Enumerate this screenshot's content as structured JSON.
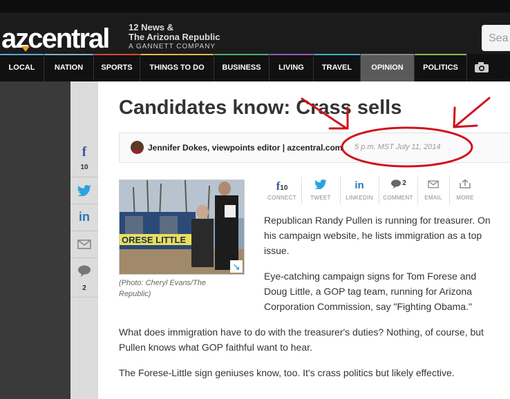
{
  "header": {
    "logo": "azcentral",
    "brand_line1": "12 News &",
    "brand_line2": "The Arizona Republic",
    "brand_line3": "A GANNETT COMPANY",
    "search_placeholder": "Sea"
  },
  "nav": {
    "items": [
      {
        "label": "LOCAL",
        "color": "#5aa7d9"
      },
      {
        "label": "NATION",
        "color": "#7fb3c9"
      },
      {
        "label": "SPORTS",
        "color": "#d14b3b"
      },
      {
        "label": "THINGS TO DO",
        "color": "#e7b94a"
      },
      {
        "label": "BUSINESS",
        "color": "#4caf73"
      },
      {
        "label": "LIVING",
        "color": "#9a59b5"
      },
      {
        "label": "TRAVEL",
        "color": "#3fb0c6"
      },
      {
        "label": "OPINION",
        "color": "#888888"
      },
      {
        "label": "POLITICS",
        "color": "#8ac055"
      }
    ],
    "active": "OPINION",
    "camera_icon": "camera-icon"
  },
  "social_rail": {
    "facebook_count": "10",
    "comment_count": "2",
    "icons": [
      "facebook-icon",
      "twitter-icon",
      "linkedin-icon",
      "email-icon",
      "comment-icon"
    ]
  },
  "article": {
    "title": "Candidates know: Crass sells",
    "author": "Jennifer Dokes, viewpoints editor | azcentral.com",
    "date": "5 p.m. MST July 11, 2014",
    "photo_caption": "(Photo: Cheryl Evans/The Republic)",
    "photo_sign_text": "ORESE LITTLE",
    "share_tools": [
      {
        "icon": "facebook-icon",
        "count": "10",
        "label": "CONNECT",
        "color": "#3b5998"
      },
      {
        "icon": "twitter-icon",
        "count": "",
        "label": "TWEET",
        "color": "#2aa3e0"
      },
      {
        "icon": "linkedin-icon",
        "count": "",
        "label": "LINKEDIN",
        "color": "#2676b3"
      },
      {
        "icon": "comment-icon",
        "count": "2",
        "label": "COMMENT",
        "color": "#666666"
      },
      {
        "icon": "email-icon",
        "count": "",
        "label": "EMAIL",
        "color": "#777777"
      },
      {
        "icon": "more-icon",
        "count": "",
        "label": "MORE",
        "color": "#777777"
      }
    ],
    "paragraphs": [
      "Republican Randy Pullen is running for treasurer. On his campaign website, he lists immigration as a top issue.",
      "Eye-catching campaign signs for Tom Forese and Doug Little, a GOP tag team, running for Arizona Corporation Commission, say \"Fighting Obama.\"",
      "What does immigration have to do with the treasurer's duties? Nothing, of course, but Pullen knows what GOP faithful want to hear.",
      "The Forese-Little sign geniuses know, too. It's crass politics but likely effective."
    ]
  },
  "annotation_color": "#d0121b"
}
